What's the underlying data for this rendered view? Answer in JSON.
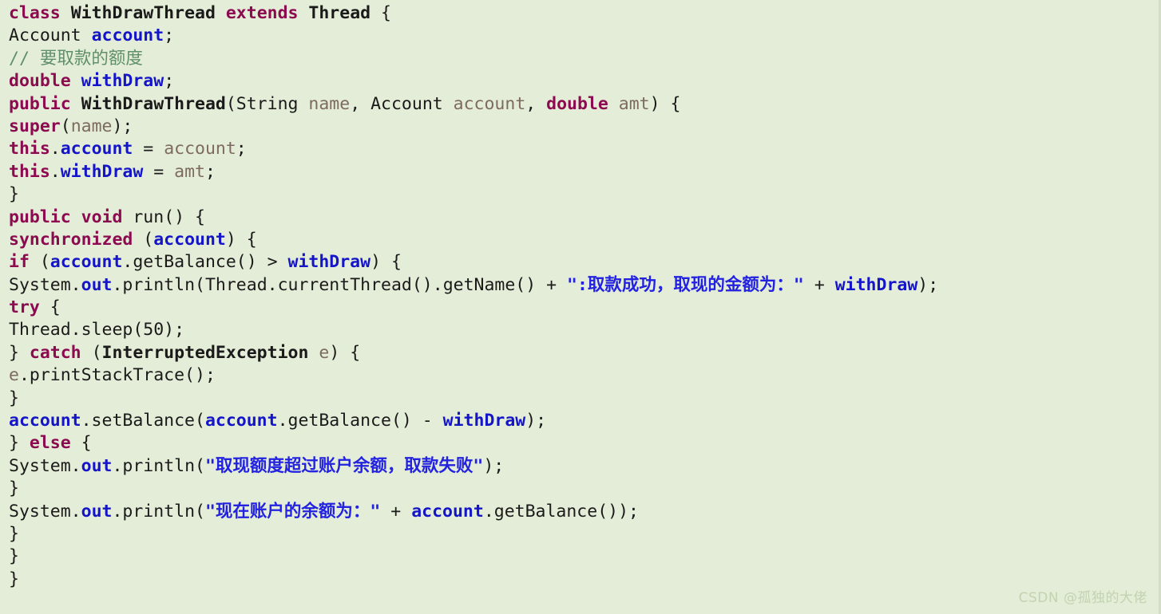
{
  "editor": {
    "background_color": "#e4edd7",
    "language": "java",
    "font_size_px": 21.5,
    "line_height_px": 28.4,
    "theme_colors": {
      "keyword": "#8c0b50",
      "type": "#1a1a1a",
      "field": "#1414c8",
      "parameter": "#7d6a60",
      "string": "#2222e0",
      "comment": "#5f8f6b",
      "plain": "#1a1a1a"
    }
  },
  "watermark": {
    "text": "CSDN @孤独的大佬"
  },
  "code": {
    "lines": [
      {
        "id": 1,
        "text": "class WithDrawThread extends Thread {",
        "tokens": [
          {
            "t": "class",
            "c": "kw"
          },
          {
            "t": " ",
            "c": "plain"
          },
          {
            "t": "WithDrawThread",
            "c": "type"
          },
          {
            "t": " ",
            "c": "plain"
          },
          {
            "t": "extends",
            "c": "kw"
          },
          {
            "t": " ",
            "c": "plain"
          },
          {
            "t": "Thread",
            "c": "type"
          },
          {
            "t": " {",
            "c": "plain"
          }
        ]
      },
      {
        "id": 2,
        "text": "Account account;",
        "tokens": [
          {
            "t": "Account",
            "c": "plain"
          },
          {
            "t": " ",
            "c": "plain"
          },
          {
            "t": "account",
            "c": "fld"
          },
          {
            "t": ";",
            "c": "plain"
          }
        ]
      },
      {
        "id": 3,
        "text": "// 要取款的额度",
        "tokens": [
          {
            "t": "// 要取款的额度",
            "c": "cmt"
          }
        ]
      },
      {
        "id": 4,
        "text": "double withDraw;",
        "tokens": [
          {
            "t": "double",
            "c": "kw"
          },
          {
            "t": " ",
            "c": "plain"
          },
          {
            "t": "withDraw",
            "c": "fld"
          },
          {
            "t": ";",
            "c": "plain"
          }
        ]
      },
      {
        "id": 5,
        "text": "public WithDrawThread(String name, Account account, double amt) {",
        "tokens": [
          {
            "t": "public",
            "c": "kw"
          },
          {
            "t": " ",
            "c": "plain"
          },
          {
            "t": "WithDrawThread",
            "c": "type"
          },
          {
            "t": "(",
            "c": "plain"
          },
          {
            "t": "String",
            "c": "plain"
          },
          {
            "t": " ",
            "c": "plain"
          },
          {
            "t": "name",
            "c": "par"
          },
          {
            "t": ", ",
            "c": "plain"
          },
          {
            "t": "Account",
            "c": "plain"
          },
          {
            "t": " ",
            "c": "plain"
          },
          {
            "t": "account",
            "c": "par"
          },
          {
            "t": ", ",
            "c": "plain"
          },
          {
            "t": "double",
            "c": "kw"
          },
          {
            "t": " ",
            "c": "plain"
          },
          {
            "t": "amt",
            "c": "par"
          },
          {
            "t": ") {",
            "c": "plain"
          }
        ]
      },
      {
        "id": 6,
        "text": "super(name);",
        "tokens": [
          {
            "t": "super",
            "c": "kw"
          },
          {
            "t": "(",
            "c": "plain"
          },
          {
            "t": "name",
            "c": "par"
          },
          {
            "t": ");",
            "c": "plain"
          }
        ]
      },
      {
        "id": 7,
        "text": "this.account = account;",
        "tokens": [
          {
            "t": "this",
            "c": "kw"
          },
          {
            "t": ".",
            "c": "plain"
          },
          {
            "t": "account",
            "c": "fld"
          },
          {
            "t": " = ",
            "c": "plain"
          },
          {
            "t": "account",
            "c": "par"
          },
          {
            "t": ";",
            "c": "plain"
          }
        ]
      },
      {
        "id": 8,
        "text": "this.withDraw = amt;",
        "tokens": [
          {
            "t": "this",
            "c": "kw"
          },
          {
            "t": ".",
            "c": "plain"
          },
          {
            "t": "withDraw",
            "c": "fld"
          },
          {
            "t": " = ",
            "c": "plain"
          },
          {
            "t": "amt",
            "c": "par"
          },
          {
            "t": ";",
            "c": "plain"
          }
        ]
      },
      {
        "id": 9,
        "text": "}",
        "tokens": [
          {
            "t": "}",
            "c": "plain"
          }
        ]
      },
      {
        "id": 10,
        "text": "public void run() {",
        "tokens": [
          {
            "t": "public",
            "c": "kw"
          },
          {
            "t": " ",
            "c": "plain"
          },
          {
            "t": "void",
            "c": "kw"
          },
          {
            "t": " ",
            "c": "plain"
          },
          {
            "t": "run",
            "c": "plain"
          },
          {
            "t": "() {",
            "c": "plain"
          }
        ]
      },
      {
        "id": 11,
        "text": "synchronized (account) {",
        "tokens": [
          {
            "t": "synchronized",
            "c": "kw"
          },
          {
            "t": " (",
            "c": "plain"
          },
          {
            "t": "account",
            "c": "fld"
          },
          {
            "t": ") {",
            "c": "plain"
          }
        ]
      },
      {
        "id": 12,
        "text": "if (account.getBalance() > withDraw) {",
        "tokens": [
          {
            "t": "if",
            "c": "kw"
          },
          {
            "t": " (",
            "c": "plain"
          },
          {
            "t": "account",
            "c": "fld"
          },
          {
            "t": ".getBalance() > ",
            "c": "plain"
          },
          {
            "t": "withDraw",
            "c": "fld"
          },
          {
            "t": ") {",
            "c": "plain"
          }
        ]
      },
      {
        "id": 13,
        "text": "System.out.println(Thread.currentThread().getName() + \":取款成功，取现的金额为：\" + withDraw);",
        "tokens": [
          {
            "t": "System",
            "c": "plain"
          },
          {
            "t": ".",
            "c": "plain"
          },
          {
            "t": "out",
            "c": "fld"
          },
          {
            "t": ".println(",
            "c": "plain"
          },
          {
            "t": "Thread",
            "c": "plain"
          },
          {
            "t": ".currentThread().getName() + ",
            "c": "plain"
          },
          {
            "t": "\":取款成功，取现的金额为：\"",
            "c": "str"
          },
          {
            "t": " + ",
            "c": "plain"
          },
          {
            "t": "withDraw",
            "c": "fld"
          },
          {
            "t": ");",
            "c": "plain"
          }
        ]
      },
      {
        "id": 14,
        "text": "try {",
        "tokens": [
          {
            "t": "try",
            "c": "kw"
          },
          {
            "t": " {",
            "c": "plain"
          }
        ]
      },
      {
        "id": 15,
        "text": "Thread.sleep(50);",
        "tokens": [
          {
            "t": "Thread",
            "c": "plain"
          },
          {
            "t": ".sleep(",
            "c": "plain"
          },
          {
            "t": "50",
            "c": "num"
          },
          {
            "t": ");",
            "c": "plain"
          }
        ]
      },
      {
        "id": 16,
        "text": "} catch (InterruptedException e) {",
        "tokens": [
          {
            "t": "} ",
            "c": "plain"
          },
          {
            "t": "catch",
            "c": "kw"
          },
          {
            "t": " (",
            "c": "plain"
          },
          {
            "t": "InterruptedException",
            "c": "type"
          },
          {
            "t": " ",
            "c": "plain"
          },
          {
            "t": "e",
            "c": "par"
          },
          {
            "t": ") {",
            "c": "plain"
          }
        ]
      },
      {
        "id": 17,
        "text": "e.printStackTrace();",
        "tokens": [
          {
            "t": "e",
            "c": "par"
          },
          {
            "t": ".printStackTrace();",
            "c": "plain"
          }
        ]
      },
      {
        "id": 18,
        "text": "}",
        "tokens": [
          {
            "t": "}",
            "c": "plain"
          }
        ]
      },
      {
        "id": 19,
        "text": "account.setBalance(account.getBalance() - withDraw);",
        "tokens": [
          {
            "t": "account",
            "c": "fld"
          },
          {
            "t": ".setBalance(",
            "c": "plain"
          },
          {
            "t": "account",
            "c": "fld"
          },
          {
            "t": ".getBalance() - ",
            "c": "plain"
          },
          {
            "t": "withDraw",
            "c": "fld"
          },
          {
            "t": ");",
            "c": "plain"
          }
        ]
      },
      {
        "id": 20,
        "text": "} else {",
        "tokens": [
          {
            "t": "} ",
            "c": "plain"
          },
          {
            "t": "else",
            "c": "kw"
          },
          {
            "t": " {",
            "c": "plain"
          }
        ]
      },
      {
        "id": 21,
        "text": "System.out.println(\"取现额度超过账户余额，取款失败\");",
        "tokens": [
          {
            "t": "System",
            "c": "plain"
          },
          {
            "t": ".",
            "c": "plain"
          },
          {
            "t": "out",
            "c": "fld"
          },
          {
            "t": ".println(",
            "c": "plain"
          },
          {
            "t": "\"取现额度超过账户余额，取款失败\"",
            "c": "str"
          },
          {
            "t": ");",
            "c": "plain"
          }
        ]
      },
      {
        "id": 22,
        "text": "}",
        "tokens": [
          {
            "t": "}",
            "c": "plain"
          }
        ]
      },
      {
        "id": 23,
        "text": "System.out.println(\"现在账户的余额为：\" + account.getBalance());",
        "tokens": [
          {
            "t": "System",
            "c": "plain"
          },
          {
            "t": ".",
            "c": "plain"
          },
          {
            "t": "out",
            "c": "fld"
          },
          {
            "t": ".println(",
            "c": "plain"
          },
          {
            "t": "\"现在账户的余额为：\"",
            "c": "str"
          },
          {
            "t": " + ",
            "c": "plain"
          },
          {
            "t": "account",
            "c": "fld"
          },
          {
            "t": ".getBalance());",
            "c": "plain"
          }
        ]
      },
      {
        "id": 24,
        "text": "}",
        "tokens": [
          {
            "t": "}",
            "c": "plain"
          }
        ]
      },
      {
        "id": 25,
        "text": "}",
        "tokens": [
          {
            "t": "}",
            "c": "plain"
          }
        ]
      },
      {
        "id": 26,
        "text": "}",
        "tokens": [
          {
            "t": "}",
            "c": "plain"
          }
        ]
      }
    ]
  }
}
